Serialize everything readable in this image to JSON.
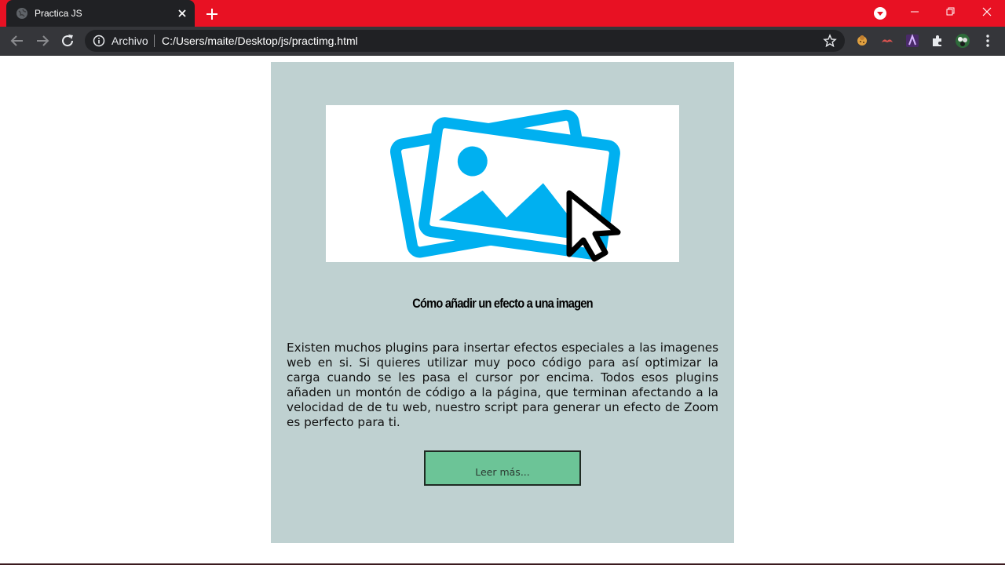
{
  "browser": {
    "tab_title": "Practica JS",
    "address": {
      "security_chip": "Archivo",
      "url": "C:/Users/maite/Desktop/js/practimg.html"
    },
    "theme_color": "#e81123",
    "icons": [
      "globe-icon",
      "close-icon",
      "plus-icon",
      "profile-icon",
      "minimize-icon",
      "restore-icon",
      "close-window-icon",
      "back-icon",
      "forward-icon",
      "reload-icon",
      "info-icon",
      "star-icon",
      "puzzle-icon",
      "menu-icon"
    ]
  },
  "page": {
    "card_color": "#bfd1d1",
    "hero_image": "image-with-cursor-icon",
    "heading": "Cómo añadir un efecto a una imagen",
    "paragraph": "Existen muchos plugins para insertar efectos especiales a las imagenes web en si. Si quieres utilizar muy poco código para así optimizar la carga cuando se les pasa el cursor por encima. Todos esos plugins añaden un montón de código a la página, que terminan afectando a la velocidad de de tu web, nuestro script para generar un efecto de Zoom es perfecto para ti.",
    "button_label": "Leer más...",
    "button_color": "#6cc497"
  }
}
